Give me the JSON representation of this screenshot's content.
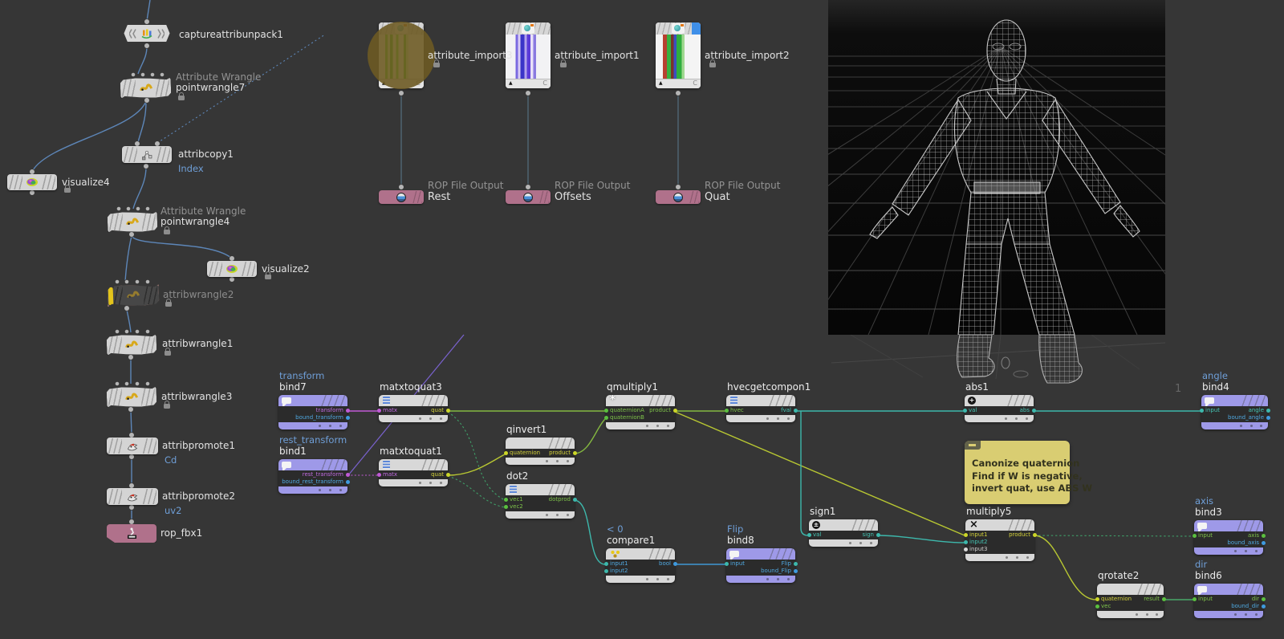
{
  "colors": {
    "background": "#363636",
    "node_gray": "#d4d4d4",
    "node_purple": "#9e99e8",
    "node_rop_pink": "#b0718b",
    "selection_ring": "#d39a90",
    "sticky_yellow": "#d9cd72",
    "label_blue": "#6f9fd8",
    "wire_sop_blue": "#5d86b8",
    "wire_green": "#84b840",
    "wire_yellow_green": "#b9c832",
    "wire_teal": "#3db8ac",
    "wire_blue": "#3e97d4",
    "wire_magenta": "#c05ad6",
    "wire_purple": "#7a62cf",
    "wire_dotted_green": "#3f9e68"
  },
  "icons": {
    "asterisk": "*",
    "multiply_x": "×",
    "plus_minus": "±",
    "plus": "+",
    "cook_triangle": "▲",
    "cache_c": "C"
  },
  "sop": {
    "captureattribunpack1": {
      "name": "captureattribunpack1"
    },
    "pointwrangle7": {
      "type_label": "Attribute Wrangle",
      "name": "pointwrangle7"
    },
    "attribcopy1": {
      "name": "attribcopy1",
      "sublabel": "Index"
    },
    "visualize4": {
      "name": "visualize4"
    },
    "pointwrangle4": {
      "type_label": "Attribute Wrangle",
      "name": "pointwrangle4"
    },
    "visualize2": {
      "name": "visualize2"
    },
    "attribwrangle2": {
      "name": "attribwrangle2"
    },
    "attribwrangle1": {
      "name": "attribwrangle1"
    },
    "attribwrangle3": {
      "name": "attribwrangle3"
    },
    "attribpromote1": {
      "name": "attribpromote1",
      "sublabel": "Cd"
    },
    "attribpromote2": {
      "name": "attribpromote2",
      "sublabel": "uv2"
    },
    "rop_fbx1": {
      "name": "rop_fbx1"
    }
  },
  "tops": {
    "attribute_import3": {
      "name": "attribute_import3"
    },
    "attribute_import1": {
      "name": "attribute_import1"
    },
    "attribute_import2": {
      "name": "attribute_import2"
    },
    "rop_rest": {
      "type_label": "ROP File Output",
      "name": "Rest"
    },
    "rop_offsets": {
      "type_label": "ROP File Output",
      "name": "Offsets"
    },
    "rop_quat": {
      "type_label": "ROP File Output",
      "name": "Quat"
    }
  },
  "vop": {
    "bind7": {
      "context_label": "transform",
      "name": "bind7",
      "out1": "transform",
      "out2": "bound_transform"
    },
    "matxtoquat3": {
      "name": "matxtoquat3",
      "in1": "matx",
      "out1": "quat"
    },
    "bind1": {
      "context_label": "rest_transform",
      "name": "bind1",
      "out1": "rest_transform",
      "out2": "bound_rest_transform"
    },
    "matxtoquat1": {
      "name": "matxtoquat1",
      "in1": "matx",
      "out1": "quat"
    },
    "qinvert1": {
      "name": "qinvert1",
      "in1": "quaternion",
      "out1": "product"
    },
    "dot2": {
      "name": "dot2",
      "in1": "vec1",
      "in2": "vec2",
      "out1": "dotprod"
    },
    "qmultiply1": {
      "name": "qmultiply1",
      "in1": "quaternionA",
      "in2": "quaternionB",
      "out1": "product"
    },
    "hvecgetcompon1": {
      "name": "hvecgetcompon1",
      "in1": "hvec",
      "out1": "fval"
    },
    "compare1": {
      "context_label": "< 0",
      "name": "compare1",
      "in1": "input1",
      "in2": "input2",
      "out1": "bool"
    },
    "bind8": {
      "context_label": "Flip",
      "name": "bind8",
      "in1": "input",
      "out1": "Flip",
      "out2": "bound_Flip"
    },
    "sign1": {
      "name": "sign1",
      "in1": "val",
      "out1": "sign"
    },
    "multiply5": {
      "name": "multiply5",
      "in1": "input1",
      "in2": "input2",
      "in3": "input3",
      "out1": "product"
    },
    "abs1": {
      "name": "abs1",
      "in1": "val",
      "out1": "abs"
    },
    "bind4": {
      "context_label": "angle",
      "name": "bind4",
      "in1": "input",
      "out1": "angle",
      "out2": "bound_angle"
    },
    "bind3": {
      "context_label": "axis",
      "name": "bind3",
      "in1": "input",
      "out1": "axis",
      "out2": "bound_axis"
    },
    "qrotate2": {
      "name": "qrotate2",
      "in1": "quaternion",
      "in2": "vec",
      "out1": "result"
    },
    "bind6": {
      "context_label": "dir",
      "name": "bind6",
      "in1": "input",
      "out1": "dir",
      "out2": "bound_dir"
    }
  },
  "sticky_note": {
    "line1": "Canonize quaternion",
    "line2": "Find if W is negative,",
    "line3": "invert quat, use ABS W"
  },
  "viewport": {
    "ground_label": "1"
  }
}
